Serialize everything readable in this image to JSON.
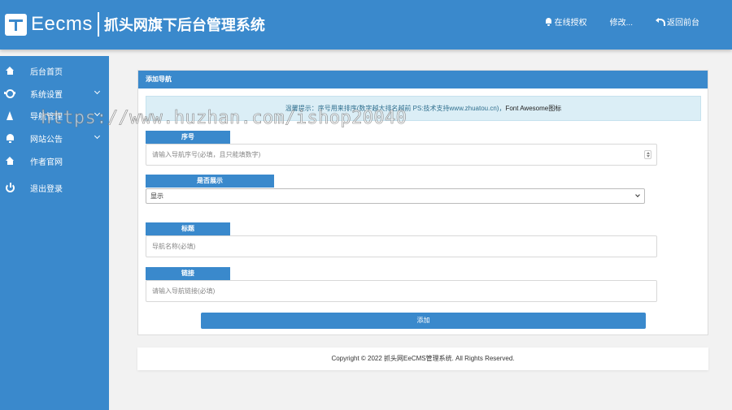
{
  "header": {
    "logo_text": "Eecms",
    "system_title": "抓头网旗下后台管理系统",
    "actions": [
      {
        "label": "在线授权",
        "icon": "bell-icon"
      },
      {
        "label": "修改...",
        "icon": ""
      },
      {
        "label": "返回前台",
        "icon": "undo-icon"
      }
    ]
  },
  "sidebar": {
    "items": [
      {
        "label": "后台首页",
        "icon": "home-icon",
        "has_submenu": false
      },
      {
        "label": "系统设置",
        "icon": "gear-icon",
        "has_submenu": true
      },
      {
        "label": "导航管理",
        "icon": "navigation-icon",
        "has_submenu": true
      },
      {
        "label": "网站公告",
        "icon": "bell-icon",
        "has_submenu": true
      },
      {
        "label": "作者官网",
        "icon": "home-icon",
        "has_submenu": false
      },
      {
        "label": "退出登录",
        "icon": "power-icon",
        "has_submenu": false
      }
    ]
  },
  "panel": {
    "title": "添加导航",
    "notice": "温馨提示：序号用来排序(数字越大排名越前 PS:技术支持www.zhuatou.cn)，",
    "notice_tail": "Font Awesome图标",
    "fields": {
      "order": {
        "label": "序号",
        "placeholder": "请输入导航序号(必填，且只能填数字)"
      },
      "show": {
        "label": "是否展示",
        "value": "显示"
      },
      "title": {
        "label": "标题",
        "placeholder": "导航名称(必填)"
      },
      "link": {
        "label": "链接",
        "placeholder": "请输入导航链接(必填)"
      }
    },
    "submit_label": "添加"
  },
  "footer": {
    "copyright": "Copyright © 2022 抓头网EeCMS管理系统. All Rights Reserved."
  },
  "watermark": "https://www.huzhan.com/ishop20040",
  "colors": {
    "primary": "#3a89cc",
    "notice_bg": "#dbeef6",
    "page_bg": "#f2f2f2"
  }
}
